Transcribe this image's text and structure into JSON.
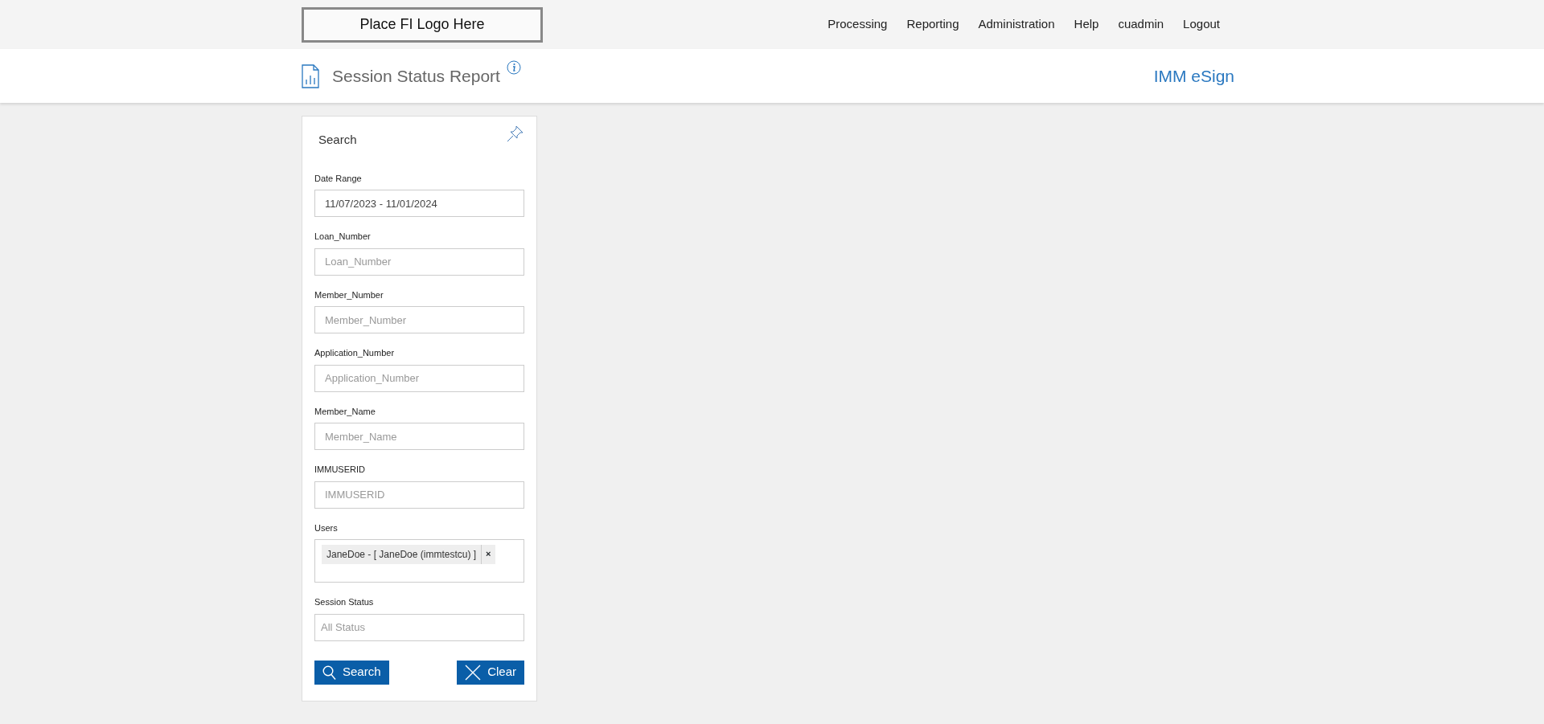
{
  "header": {
    "logo_placeholder": "Place FI Logo Here",
    "nav": [
      "Processing",
      "Reporting",
      "Administration",
      "Help",
      "cuadmin",
      "Logout"
    ]
  },
  "title_bar": {
    "title": "Session Status Report",
    "product": "IMM eSign"
  },
  "search_panel": {
    "title": "Search",
    "fields": [
      {
        "kind": "text",
        "label": "Date Range",
        "value": "11/07/2023 - 11/01/2024"
      },
      {
        "kind": "text",
        "label": "Loan_Number",
        "placeholder": "Loan_Number"
      },
      {
        "kind": "text",
        "label": "Member_Number",
        "placeholder": "Member_Number"
      },
      {
        "kind": "text",
        "label": "Application_Number",
        "placeholder": "Application_Number"
      },
      {
        "kind": "text",
        "label": "Member_Name",
        "placeholder": "Member_Name"
      },
      {
        "kind": "text",
        "label": "IMMUSERID",
        "placeholder": "IMMUSERID"
      },
      {
        "kind": "tags",
        "label": "Users",
        "tags": [
          {
            "text": "JaneDoe - [ JaneDoe (immtestcu) ]",
            "remove": "×"
          }
        ]
      },
      {
        "kind": "select",
        "label": "Session Status",
        "placeholder": "All Status"
      }
    ],
    "buttons": [
      {
        "kind": "search",
        "label": "Search"
      },
      {
        "kind": "clear",
        "label": "Clear"
      }
    ]
  }
}
